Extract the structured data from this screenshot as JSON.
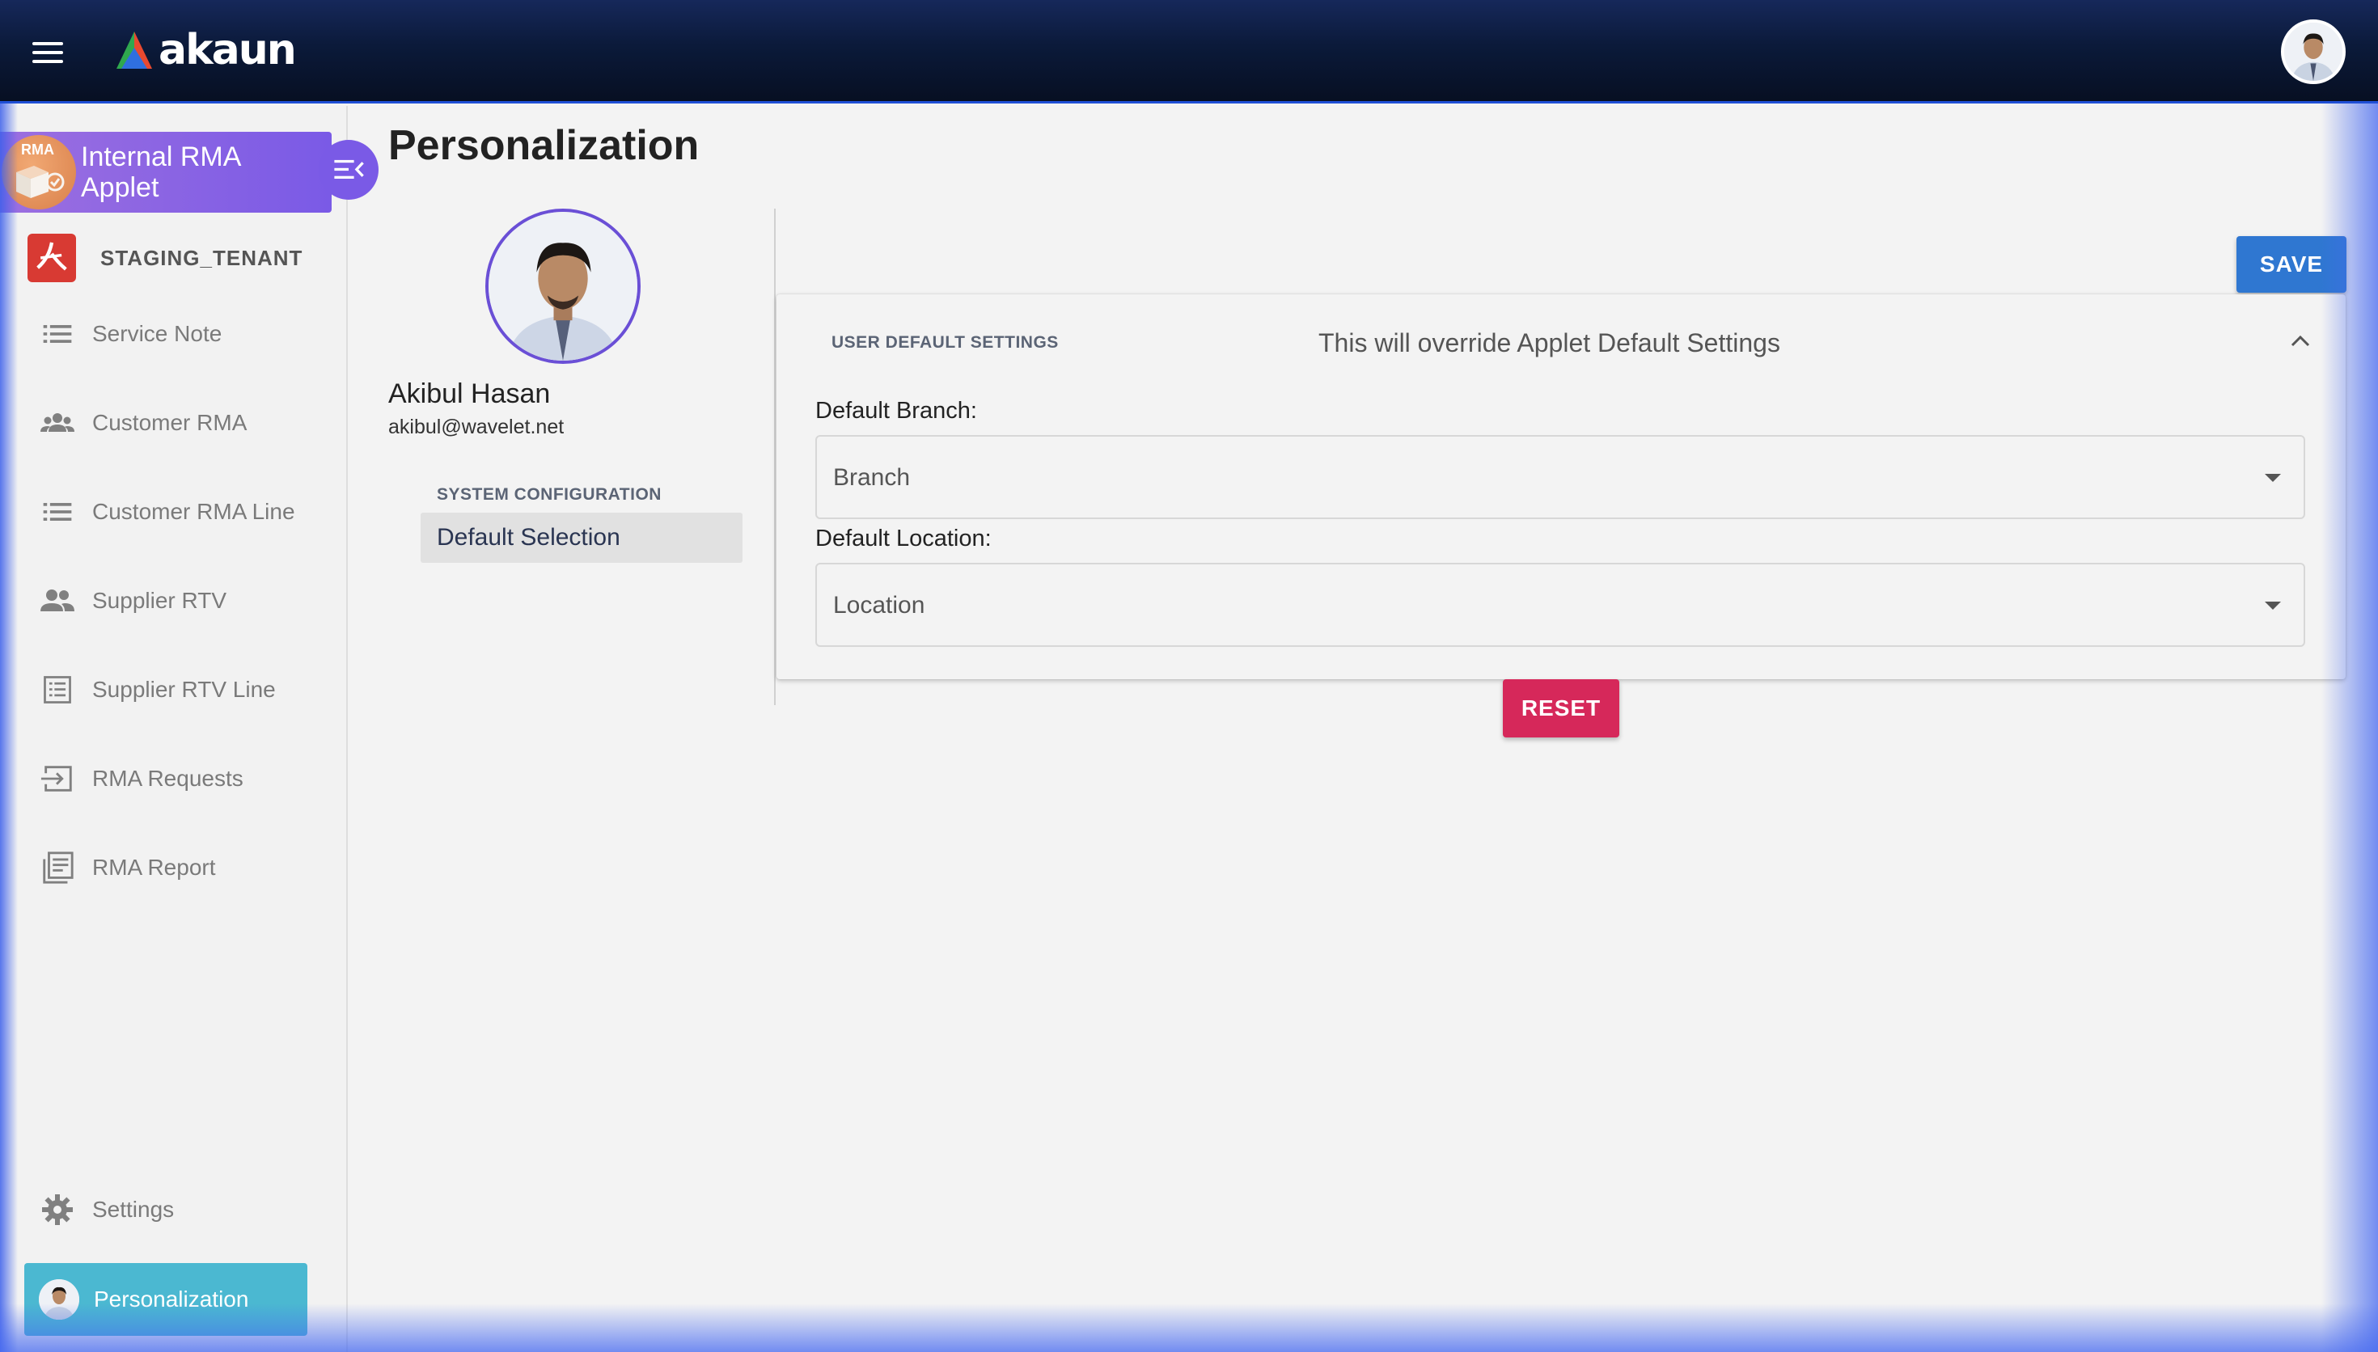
{
  "topbar": {
    "menu_icon": "hamburger-menu-icon",
    "logo_text": "akaun",
    "avatar_alt": "user-avatar"
  },
  "sidebar": {
    "applet_badge": "RMA",
    "applet_title": "Internal RMA Applet",
    "collapse_icon": "collapse-menu-icon",
    "tenant_label": "STAGING_TENANT",
    "items": [
      {
        "label": "Service Note",
        "icon": "list-icon"
      },
      {
        "label": "Customer RMA",
        "icon": "group-icon"
      },
      {
        "label": "Customer RMA Line",
        "icon": "list-icon"
      },
      {
        "label": "Supplier RTV",
        "icon": "people-icon"
      },
      {
        "label": "Supplier RTV Line",
        "icon": "list-box-icon"
      },
      {
        "label": "RMA Requests",
        "icon": "input-arrow-icon"
      },
      {
        "label": "RMA Report",
        "icon": "report-icon"
      }
    ],
    "settings_label": "Settings",
    "personalization_label": "Personalization"
  },
  "main": {
    "page_title": "Personalization",
    "profile": {
      "name": "Akibul Hasan",
      "email": "akibul@wavelet.net"
    },
    "config_section_label": "SYSTEM CONFIGURATION",
    "config_item_label": "Default Selection",
    "save_label": "SAVE",
    "reset_label": "RESET",
    "card": {
      "section_label": "USER DEFAULT SETTINGS",
      "subtitle": "This will override Applet Default Settings",
      "branch_label": "Default Branch:",
      "branch_placeholder": "Branch",
      "location_label": "Default Location:",
      "location_placeholder": "Location"
    }
  },
  "colors": {
    "accent_purple": "#7a5ae6",
    "save_blue": "#2f77d1",
    "reset_red": "#d6285a",
    "active_teal": "#4bb8d1",
    "topbar_navy": "#0b1a3a"
  }
}
